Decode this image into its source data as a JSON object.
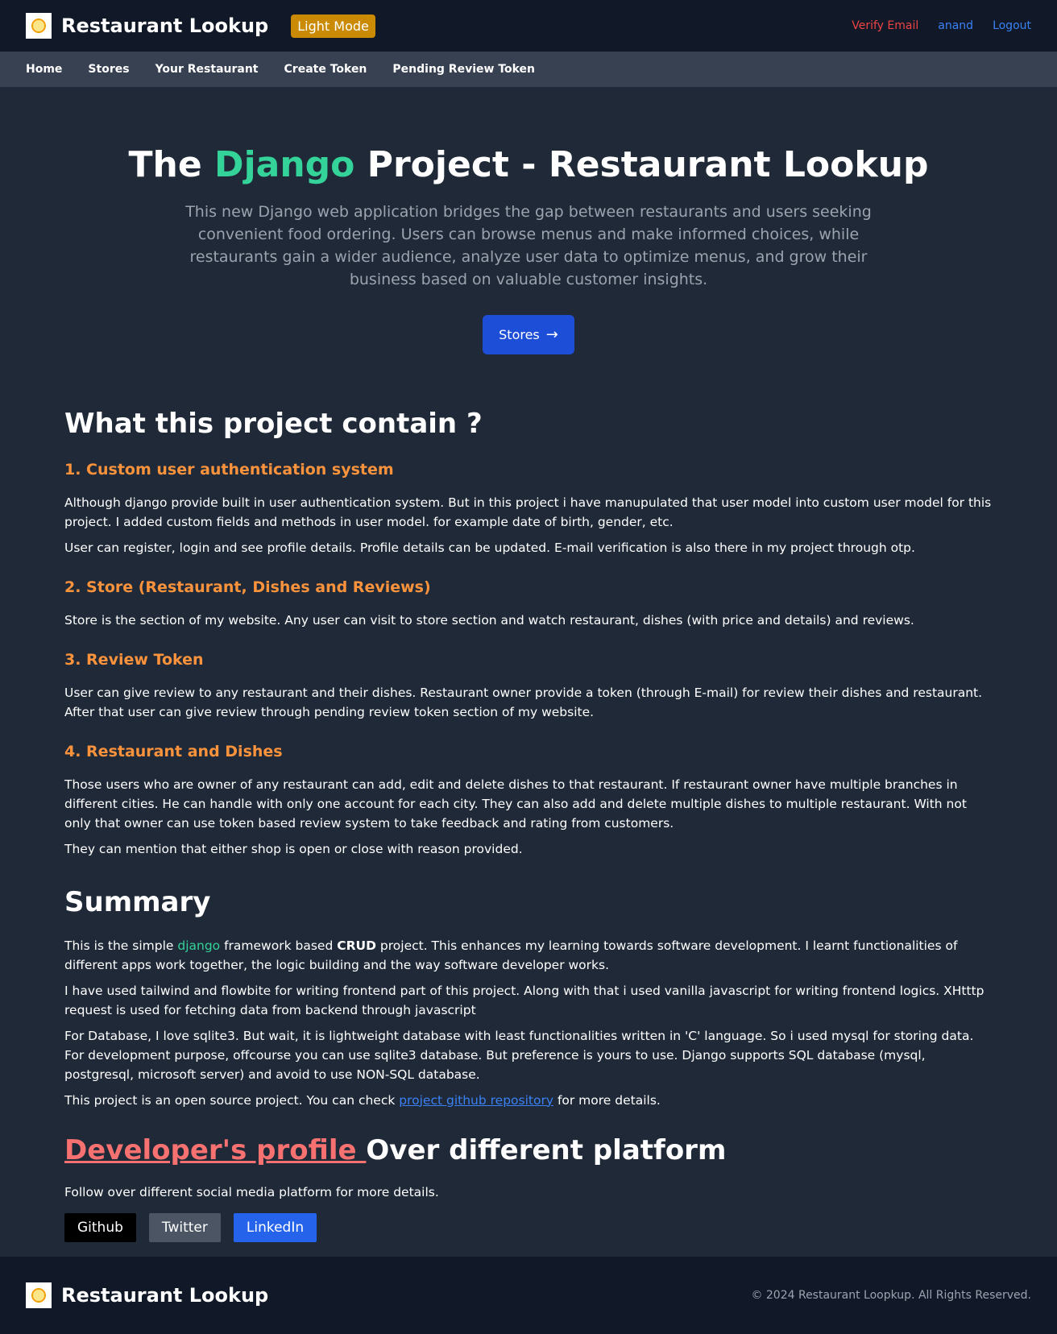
{
  "header": {
    "brand": "Restaurant Lookup",
    "mode_button": "Light Mode",
    "links": {
      "verify_email": "Verify Email",
      "user": "anand",
      "logout": "Logout"
    }
  },
  "nav": {
    "items": [
      "Home",
      "Stores",
      "Your Restaurant",
      "Create Token",
      "Pending Review Token"
    ]
  },
  "hero": {
    "title_pre": "The ",
    "title_accent": "Django",
    "title_post": " Project - Restaurant Lookup",
    "description": "This new Django web application bridges the gap between restaurants and users seeking convenient food ordering. Users can browse menus and make informed choices, while restaurants gain a wider audience, analyze user data to optimize menus, and grow their business based on valuable customer insights.",
    "button": "Stores",
    "button_icon": "→"
  },
  "contains": {
    "title": "What this project contain ?",
    "sections": [
      {
        "heading": "1. Custom user authentication system",
        "paragraphs": [
          "Although django provide built in user authentication system. But in this project i have manupulated that user model into custom user model for this project. I added custom fields and methods in user model. for example date of birth, gender, etc.",
          "User can register, login and see profile details. Profile details can be updated. E-mail verification is also there in my project through otp."
        ]
      },
      {
        "heading": "2. Store (Restaurant, Dishes and Reviews)",
        "paragraphs": [
          "Store is the section of my website. Any user can visit to store section and watch restaurant, dishes (with price and details) and reviews."
        ]
      },
      {
        "heading": "3. Review Token",
        "paragraphs": [
          "User can give review to any restaurant and their dishes. Restaurant owner provide a token (through E-mail) for review their dishes and restaurant. After that user can give review through pending review token section of my website."
        ]
      },
      {
        "heading": "4. Restaurant and Dishes",
        "paragraphs": [
          "Those users who are owner of any restaurant can add, edit and delete dishes to that restaurant. If restaurant owner have multiple branches in different cities. He can handle with only one account for each city. They can also add and delete multiple dishes to multiple restaurant. With not only that owner can use token based review system to take feedback and rating from customers.",
          "They can mention that either shop is open or close with reason provided."
        ]
      }
    ]
  },
  "summary": {
    "title": "Summary",
    "p1_a": "This is the simple ",
    "p1_django": "django",
    "p1_b": " framework based ",
    "p1_crud": "CRUD",
    "p1_c": " project. This enhances my learning towards software development. I learnt functionalities of different apps work together, the logic building and the way software developer works.",
    "p2": "I have used tailwind and flowbite for writing frontend part of this project. Along with that i used vanilla javascript for writing frontend logics. XHtttp request is used for fetching data from backend through javascript",
    "p3": "For Database, I love sqlite3. But wait, it is lightweight database with least functionalities written in 'C' language. So i used mysql for storing data. For development purpose, offcourse you can use sqlite3 database. But preference is yours to use. Django supports SQL database (mysql, postgresql, microsoft server) and avoid to use NON-SQL database.",
    "p4_a": "This project is an open source project. You can check ",
    "p4_link": "project github repository",
    "p4_b": " for more details."
  },
  "developer": {
    "title_link": "Developer's profile ",
    "title_rest": "Over different platform",
    "text": "Follow over different social media platform for more details.",
    "buttons": {
      "github": "Github",
      "twitter": "Twitter",
      "linkedin": "LinkedIn"
    }
  },
  "footer": {
    "brand": "Restaurant Lookup",
    "copyright": "© 2024 Restaurant Loopkup. All Rights Reserved."
  },
  "colors": {
    "bg": "#1f2937",
    "topbar": "#111827",
    "navbar": "#374151",
    "accent_green": "#34d399",
    "accent_orange": "#fb923c",
    "accent_red": "#f87171",
    "primary_blue": "#1d4ed8",
    "mode_button": "#ca8a04"
  },
  "icons": {
    "logo": "restaurant-logo-icon",
    "arrow": "arrow-right-icon"
  }
}
